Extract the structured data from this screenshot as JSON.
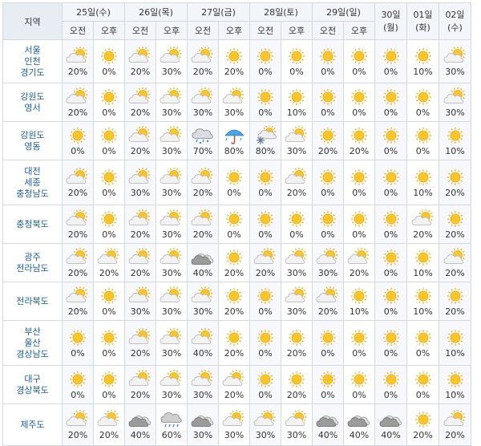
{
  "header": {
    "area_label": "지역",
    "days": [
      {
        "label": "25일(수)",
        "split": true
      },
      {
        "label": "26일(목)",
        "split": true
      },
      {
        "label": "27일(금)",
        "split": true
      },
      {
        "label": "28일(토)",
        "split": true
      },
      {
        "label": "29일(일)",
        "split": true
      },
      {
        "label": "30일(월)",
        "split": false
      },
      {
        "label": "01일(화)",
        "split": false
      },
      {
        "label": "02일(수)",
        "split": false
      }
    ],
    "am": "오전",
    "pm": "오후"
  },
  "rows": [
    {
      "region": "서울\n인천\n경기도",
      "cells": [
        [
          "partly-cloudy",
          "20%"
        ],
        [
          "sunny",
          "0%"
        ],
        [
          "partly-cloudy",
          "20%"
        ],
        [
          "partly-cloudy",
          "30%"
        ],
        [
          "partly-cloudy",
          "20%"
        ],
        [
          "sunny",
          "20%"
        ],
        [
          "sunny",
          "0%"
        ],
        [
          "sunny",
          "0%"
        ],
        [
          "sunny",
          "0%"
        ],
        [
          "sunny",
          "0%"
        ],
        [
          "sunny",
          "0%"
        ],
        [
          "sunny",
          "10%"
        ],
        [
          "partly-cloudy",
          "30%"
        ]
      ]
    },
    {
      "region": "강원도\n영서",
      "cells": [
        [
          "partly-cloudy",
          "20%"
        ],
        [
          "sunny",
          "0%"
        ],
        [
          "partly-cloudy",
          "20%"
        ],
        [
          "partly-cloudy",
          "30%"
        ],
        [
          "partly-cloudy",
          "30%"
        ],
        [
          "partly-cloudy",
          "30%"
        ],
        [
          "sunny",
          "0%"
        ],
        [
          "sunny",
          "10%"
        ],
        [
          "sunny",
          "0%"
        ],
        [
          "sunny",
          "0%"
        ],
        [
          "sunny",
          "0%"
        ],
        [
          "sunny",
          "0%"
        ],
        [
          "partly-cloudy",
          "30%"
        ]
      ]
    },
    {
      "region": "강원도\n영동",
      "cells": [
        [
          "sunny",
          "0%"
        ],
        [
          "sunny",
          "0%"
        ],
        [
          "partly-cloudy",
          "20%"
        ],
        [
          "partly-cloudy",
          "30%"
        ],
        [
          "rain-snow",
          "70%"
        ],
        [
          "umbrella",
          "80%"
        ],
        [
          "snow-cloud",
          "80%"
        ],
        [
          "partly-cloudy",
          "30%"
        ],
        [
          "sunny",
          "20%"
        ],
        [
          "sunny",
          "20%"
        ],
        [
          "sunny",
          "0%"
        ],
        [
          "sunny",
          "0%"
        ],
        [
          "sunny",
          "10%"
        ]
      ]
    },
    {
      "region": "대전\n세종\n충청남도",
      "cells": [
        [
          "partly-cloudy",
          "20%"
        ],
        [
          "sunny",
          "0%"
        ],
        [
          "partly-cloudy",
          "30%"
        ],
        [
          "partly-cloudy",
          "30%"
        ],
        [
          "partly-cloudy",
          "20%"
        ],
        [
          "sunny",
          "0%"
        ],
        [
          "sunny",
          "0%"
        ],
        [
          "partly-cloudy",
          "20%"
        ],
        [
          "sunny",
          "0%"
        ],
        [
          "sunny",
          "0%"
        ],
        [
          "sunny",
          "0%"
        ],
        [
          "sunny",
          "10%"
        ],
        [
          "sunny",
          "20%"
        ]
      ]
    },
    {
      "region": "충청북도",
      "cells": [
        [
          "partly-cloudy",
          "20%"
        ],
        [
          "sunny",
          "0%"
        ],
        [
          "partly-cloudy",
          "20%"
        ],
        [
          "partly-cloudy",
          "30%"
        ],
        [
          "partly-cloudy",
          "20%"
        ],
        [
          "sunny",
          "0%"
        ],
        [
          "sunny",
          "0%"
        ],
        [
          "sunny",
          "0%"
        ],
        [
          "sunny",
          "0%"
        ],
        [
          "sunny",
          "0%"
        ],
        [
          "sunny",
          "0%"
        ],
        [
          "partly-cloudy",
          "20%"
        ],
        [
          "sunny",
          "20%"
        ]
      ]
    },
    {
      "region": "광주\n전라남도",
      "cells": [
        [
          "partly-cloudy",
          "20%"
        ],
        [
          "partly-cloudy",
          "20%"
        ],
        [
          "partly-cloudy",
          "20%"
        ],
        [
          "partly-cloudy",
          "30%"
        ],
        [
          "cloudy",
          "40%"
        ],
        [
          "sunny",
          "20%"
        ],
        [
          "partly-cloudy",
          "20%"
        ],
        [
          "partly-cloudy",
          "30%"
        ],
        [
          "partly-cloudy",
          "30%"
        ],
        [
          "partly-cloudy",
          "20%"
        ],
        [
          "sunny",
          "0%"
        ],
        [
          "sunny",
          "10%"
        ],
        [
          "partly-cloudy",
          "20%"
        ]
      ]
    },
    {
      "region": "전라북도",
      "cells": [
        [
          "partly-cloudy",
          "20%"
        ],
        [
          "sunny",
          "0%"
        ],
        [
          "partly-cloudy",
          "30%"
        ],
        [
          "partly-cloudy",
          "30%"
        ],
        [
          "partly-cloudy",
          "30%"
        ],
        [
          "sunny",
          "20%"
        ],
        [
          "sunny",
          "0%"
        ],
        [
          "partly-cloudy",
          "30%"
        ],
        [
          "partly-cloudy",
          "20%"
        ],
        [
          "sunny",
          "10%"
        ],
        [
          "sunny",
          "0%"
        ],
        [
          "sunny",
          "10%"
        ],
        [
          "sunny",
          "20%"
        ]
      ]
    },
    {
      "region": "부산\n울산\n경상남도",
      "cells": [
        [
          "sunny",
          "0%"
        ],
        [
          "sunny",
          "0%"
        ],
        [
          "partly-cloudy",
          "20%"
        ],
        [
          "partly-cloudy",
          "30%"
        ],
        [
          "partly-cloudy",
          "40%"
        ],
        [
          "sunny",
          "20%"
        ],
        [
          "sunny",
          "0%"
        ],
        [
          "sunny",
          "20%"
        ],
        [
          "sunny",
          "0%"
        ],
        [
          "sunny",
          "0%"
        ],
        [
          "sunny",
          "0%"
        ],
        [
          "sunny",
          "0%"
        ],
        [
          "sunny",
          "10%"
        ]
      ]
    },
    {
      "region": "대구\n경상북도",
      "cells": [
        [
          "sunny",
          "0%"
        ],
        [
          "sunny",
          "0%"
        ],
        [
          "partly-cloudy",
          "20%"
        ],
        [
          "partly-cloudy",
          "30%"
        ],
        [
          "partly-cloudy",
          "30%"
        ],
        [
          "partly-cloudy",
          "20%"
        ],
        [
          "sunny",
          "0%"
        ],
        [
          "sunny",
          "20%"
        ],
        [
          "sunny",
          "0%"
        ],
        [
          "sunny",
          "0%"
        ],
        [
          "sunny",
          "0%"
        ],
        [
          "sunny",
          "0%"
        ],
        [
          "sunny",
          "10%"
        ]
      ]
    },
    {
      "region": "제주도",
      "cells": [
        [
          "partly-cloudy",
          "20%"
        ],
        [
          "partly-cloudy",
          "20%"
        ],
        [
          "cloudy",
          "40%"
        ],
        [
          "rain-cloud",
          "60%"
        ],
        [
          "cloudy",
          "30%"
        ],
        [
          "partly-cloudy",
          "30%"
        ],
        [
          "partly-cloudy",
          "30%"
        ],
        [
          "partly-cloudy",
          "30%"
        ],
        [
          "cloudy",
          "40%"
        ],
        [
          "cloudy",
          "40%"
        ],
        [
          "cloudy",
          "40%"
        ],
        [
          "sunny",
          "20%"
        ],
        [
          "partly-cloudy",
          "20%"
        ]
      ]
    }
  ]
}
